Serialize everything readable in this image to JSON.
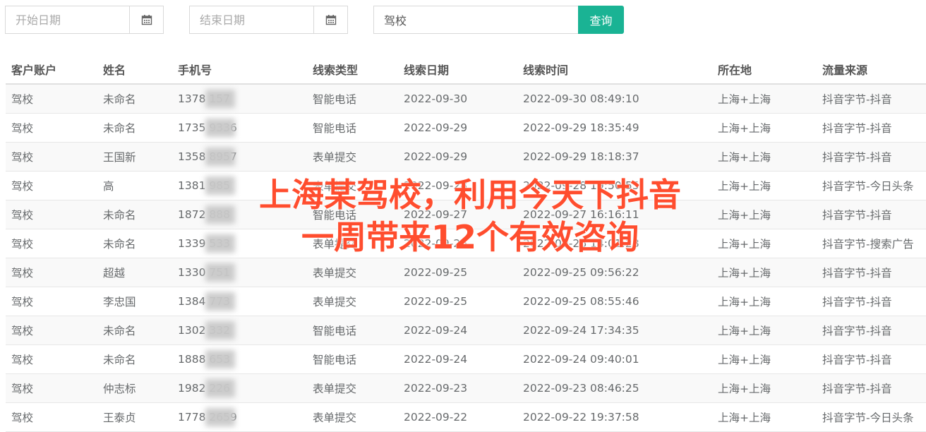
{
  "filters": {
    "start_placeholder": "开始日期",
    "end_placeholder": "结束日期",
    "keyword_value": "驾校",
    "query_label": "查询"
  },
  "table": {
    "headers": [
      "客户账户",
      "姓名",
      "手机号",
      "线索类型",
      "线索日期",
      "线索时间",
      "所在地",
      "流量来源"
    ],
    "rows": [
      [
        "驾校",
        "未命名",
        "1378      157",
        "智能电话",
        "2022-09-30",
        "2022-09-30 08:49:10",
        "上海+上海",
        "抖音字节-抖音"
      ],
      [
        "驾校",
        "未命名",
        "1735      9336",
        "智能电话",
        "2022-09-29",
        "2022-09-29 18:35:49",
        "上海+上海",
        "抖音字节-抖音"
      ],
      [
        "驾校",
        "王国新",
        "1358      8957",
        "表单提交",
        "2022-09-29",
        "2022-09-29 18:18:37",
        "上海+上海",
        "抖音字节-抖音"
      ],
      [
        "驾校",
        "高",
        "1381      985",
        "表单提交",
        "2022-09-28",
        "2022-09-28 19:50:55",
        "上海+上海",
        "抖音字节-今日头条"
      ],
      [
        "驾校",
        "未命名",
        "1872      888",
        "智能电话",
        "2022-09-27",
        "2022-09-27 16:16:11",
        "上海+上海",
        "抖音字节-抖音"
      ],
      [
        "驾校",
        "未命名",
        "1339      533",
        "表单提交",
        "2022-09-26",
        "2022-09-26 14:01:28",
        "上海+上海",
        "抖音字节-搜索广告"
      ],
      [
        "驾校",
        "超越",
        "1330      751",
        "表单提交",
        "2022-09-25",
        "2022-09-25 09:56:22",
        "上海+上海",
        "抖音字节-抖音"
      ],
      [
        "驾校",
        "李忠国",
        "1384      773",
        "表单提交",
        "2022-09-25",
        "2022-09-25 08:55:46",
        "上海+上海",
        "抖音字节-抖音"
      ],
      [
        "驾校",
        "未命名",
        "1302      332",
        "智能电话",
        "2022-09-24",
        "2022-09-24 17:34:35",
        "上海+上海",
        "抖音字节-抖音"
      ],
      [
        "驾校",
        "未命名",
        "1888      653",
        "智能电话",
        "2022-09-24",
        "2022-09-24 09:40:01",
        "上海+上海",
        "抖音字节-抖音"
      ],
      [
        "驾校",
        "仲志标",
        "1982      226",
        "表单提交",
        "2022-09-23",
        "2022-09-23 08:46:25",
        "上海+上海",
        "抖音字节-抖音"
      ],
      [
        "驾校",
        "王泰贞",
        "1778      2659",
        "表单提交",
        "2022-09-22",
        "2022-09-22 19:37:58",
        "上海+上海",
        "抖音字节-今日头条"
      ]
    ]
  },
  "overlay": {
    "line1": "上海某驾校，利用今天下抖音",
    "line2": "一周带来12个有效咨询"
  },
  "colors": {
    "accent": "#1ab394",
    "overlay_text": "#ff4d2e"
  },
  "icons": {
    "date_picker": "calendar-icon"
  }
}
